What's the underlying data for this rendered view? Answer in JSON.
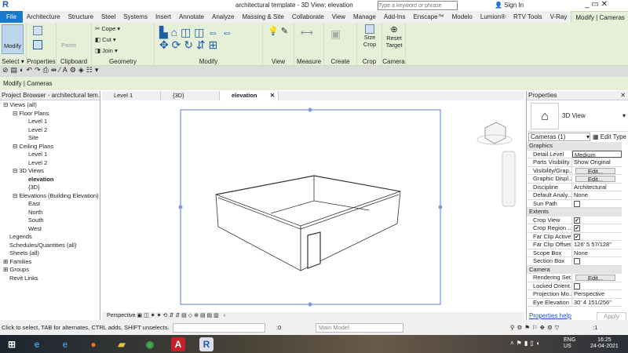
{
  "title": "architectural template - 3D View: elevation",
  "search_placeholder": "Type a keyword or phrase",
  "sign_in": "Sign In",
  "tabs": [
    "File",
    "Architecture",
    "Structure",
    "Steel",
    "Systems",
    "Insert",
    "Annotate",
    "Analyze",
    "Massing & Site",
    "Collaborate",
    "View",
    "Manage",
    "Add-Ins",
    "Enscape™",
    "Modelo",
    "Lumion®",
    "RTV Tools",
    "V-Ray",
    "Modify | Cameras"
  ],
  "ribbon": {
    "modify": "Modify",
    "select": "Select ▾",
    "properties": "Properties",
    "clipboard": "Clipboard",
    "paste": "Paste",
    "cope": "Cope",
    "cut": "Cut",
    "join": "Join",
    "geometry": "Geometry",
    "modify_panel": "Modify",
    "view": "View",
    "measure": "Measure",
    "create": "Create",
    "size_crop": "Size Crop",
    "crop": "Crop",
    "reset_target": "Reset Target",
    "camera": "Camera"
  },
  "context_label": "Modify | Cameras",
  "browser": {
    "title": "Project Browser - architectural tem...",
    "items": [
      {
        "label": "Views (all)",
        "level": 0,
        "sign": "−"
      },
      {
        "label": "Floor Plans",
        "level": 1,
        "sign": "−"
      },
      {
        "label": "Level 1",
        "level": 2
      },
      {
        "label": "Level 2",
        "level": 2
      },
      {
        "label": "Site",
        "level": 2
      },
      {
        "label": "Ceiling Plans",
        "level": 1,
        "sign": "−"
      },
      {
        "label": "Level 1",
        "level": 2
      },
      {
        "label": "Level 2",
        "level": 2
      },
      {
        "label": "3D Views",
        "level": 1,
        "sign": "−"
      },
      {
        "label": "elevation",
        "level": 2,
        "bold": true
      },
      {
        "label": "{3D}",
        "level": 2
      },
      {
        "label": "Elevations (Building Elevation)",
        "level": 1,
        "sign": "−"
      },
      {
        "label": "East",
        "level": 2
      },
      {
        "label": "North",
        "level": 2
      },
      {
        "label": "South",
        "level": 2
      },
      {
        "label": "West",
        "level": 2
      },
      {
        "label": "Legends",
        "level": 0
      },
      {
        "label": "Schedules/Quantities (all)",
        "level": 0
      },
      {
        "label": "Sheets (all)",
        "level": 0
      },
      {
        "label": "Families",
        "level": 0,
        "sign": "+"
      },
      {
        "label": "Groups",
        "level": 0,
        "sign": "+"
      },
      {
        "label": "Revit Links",
        "level": 0
      }
    ]
  },
  "view_tabs": [
    {
      "label": "Level 1"
    },
    {
      "label": "{3D}"
    },
    {
      "label": "elevation",
      "active": true
    }
  ],
  "view_bar": {
    "mode": "Perspective"
  },
  "properties": {
    "title": "Properties",
    "type": "3D View",
    "filter": "Cameras (1)",
    "edit_type": "Edit Type",
    "sections": [
      {
        "name": "Graphics",
        "rows": [
          [
            "Detail Level",
            "Medium"
          ],
          [
            "Parts Visibility",
            "Show Original"
          ],
          [
            "Visibility/Grap...",
            "Edit..."
          ],
          [
            "Graphic Displ...",
            "Edit..."
          ],
          [
            "Discipline",
            "Architectural"
          ],
          [
            "Default Analy...",
            "None"
          ],
          [
            "Sun Path",
            "unchecked"
          ]
        ]
      },
      {
        "name": "Extents",
        "rows": [
          [
            "Crop View",
            "checked"
          ],
          [
            "Crop Region ...",
            "checked"
          ],
          [
            "Far Clip Active",
            "checked"
          ],
          [
            "Far Clip Offset",
            "126'  5 57/128\""
          ],
          [
            "Scope Box",
            "None"
          ],
          [
            "Section Box",
            "unchecked"
          ]
        ]
      },
      {
        "name": "Camera",
        "rows": [
          [
            "Rendering Set...",
            "Edit..."
          ],
          [
            "Locked Orient...",
            "unchecked"
          ],
          [
            "Projection Mo...",
            "Perspective"
          ],
          [
            "Eye Elevation",
            "30'  4 151/256\""
          ]
        ]
      }
    ],
    "help": "Properties help",
    "apply": "Apply"
  },
  "status": {
    "hint": "Click to select, TAB for alternates, CTRL adds, SHIFT unselects.",
    "workset_count": ":0",
    "model": "Main Model",
    "filter_count": ":1"
  },
  "taskbar": {
    "lang1": "ENG",
    "lang2": "US",
    "time": "16:25",
    "date": "24-04-2021"
  }
}
